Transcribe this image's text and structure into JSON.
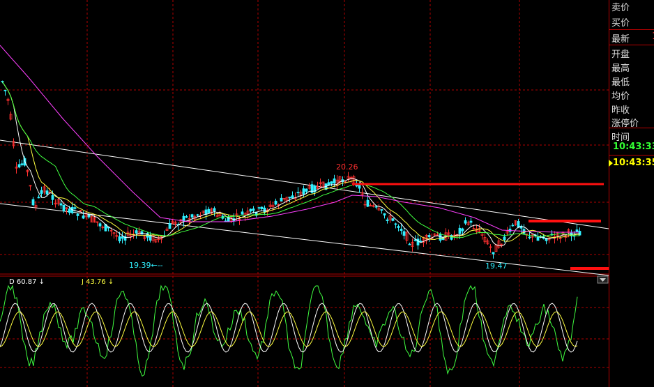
{
  "chart_data": {
    "type": "line",
    "price_annotations": {
      "high": "20.26",
      "low_left": "19.39←--",
      "low_right": "19.47"
    },
    "kdj_labels": {
      "d": "D  60.87 ↓",
      "j": "J  43.76 ↓"
    },
    "colors": {
      "up": "#ff3030",
      "down": "#30f0ff",
      "ma5": "#ffffff",
      "ma10": "#ffff40",
      "ma20": "#40ff40",
      "ma60": "#ff40ff",
      "trend": "#ffffff",
      "grid": "#b00000",
      "k": "#ffffff",
      "kd": "#ffff40",
      "j": "#40ff40"
    }
  },
  "panel": {
    "rows": [
      {
        "label": "卖价",
        "value": ""
      },
      {
        "label": "买价",
        "value": ""
      },
      {
        "label": "最新",
        "value": "1"
      },
      {
        "label": "开盘",
        "value": ""
      },
      {
        "label": "最高",
        "value": ""
      },
      {
        "label": "最低",
        "value": ""
      },
      {
        "label": "均价",
        "value": ""
      },
      {
        "label": "昨收",
        "value": ""
      },
      {
        "label": "涨停价",
        "value": ""
      }
    ],
    "time_label": "时间",
    "time1": "10:43:33",
    "time2": "10:43:35"
  }
}
